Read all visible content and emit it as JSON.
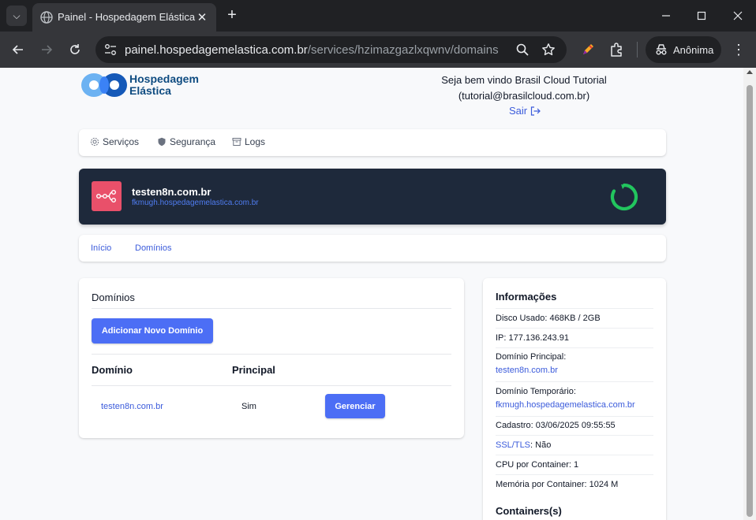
{
  "browser": {
    "tab_title": "Painel - Hospedagem Elástica",
    "url_host": "painel.hospedagemelastica.com.br",
    "url_path": "/services/hzimazgazlxqwnv/domains",
    "profile_label": "Anônima"
  },
  "header": {
    "logo_line1": "Hospedagem",
    "logo_line2": "Elástica",
    "welcome_line1": "Seja bem vindo Brasil Cloud Tutorial",
    "welcome_line2": "(tutorial@brasilcloud.com.br)",
    "logout_label": "Sair"
  },
  "menu": {
    "items": [
      {
        "label": "Serviços",
        "icon": "gear-icon"
      },
      {
        "label": "Segurança",
        "icon": "shield-icon"
      },
      {
        "label": "Logs",
        "icon": "archive-icon"
      }
    ]
  },
  "service": {
    "name": "testen8n.com.br",
    "host": "fkmugh.hospedagemelastica.com.br",
    "icon": "n8n-icon",
    "status_color": "#22c55e",
    "icon_bg": "#e9506a"
  },
  "subtabs": {
    "items": [
      {
        "label": "Início"
      },
      {
        "label": "Domínios"
      }
    ]
  },
  "domains": {
    "title": "Domínios",
    "add_button": "Adicionar Novo Domínio",
    "columns": [
      "Domínio",
      "Principal"
    ],
    "rows": [
      {
        "domain": "testen8n.com.br",
        "principal": "Sim",
        "action": "Gerenciar"
      }
    ]
  },
  "info": {
    "title": "Informações",
    "disk": "Disco Usado: 468KB / 2GB",
    "ip": "IP: 177.136.243.91",
    "main_domain_label": "Domínio Principal:",
    "main_domain_value": "testen8n.com.br",
    "temp_domain_label": "Domínio Temporário:",
    "temp_domain_value": "fkmugh.hospedagemelastica.com.br",
    "created": "Cadastro: 03/06/2025 09:55:55",
    "ssl_label": "SSL/TLS",
    "ssl_value": ": Não",
    "cpu": "CPU por Container: 1",
    "memory": "Memória por Container: 1024 M",
    "containers_title": "Containers(s)"
  },
  "colors": {
    "primary": "#4c6ef5",
    "link": "#3b5bdb",
    "banner_bg": "#1e293b"
  }
}
